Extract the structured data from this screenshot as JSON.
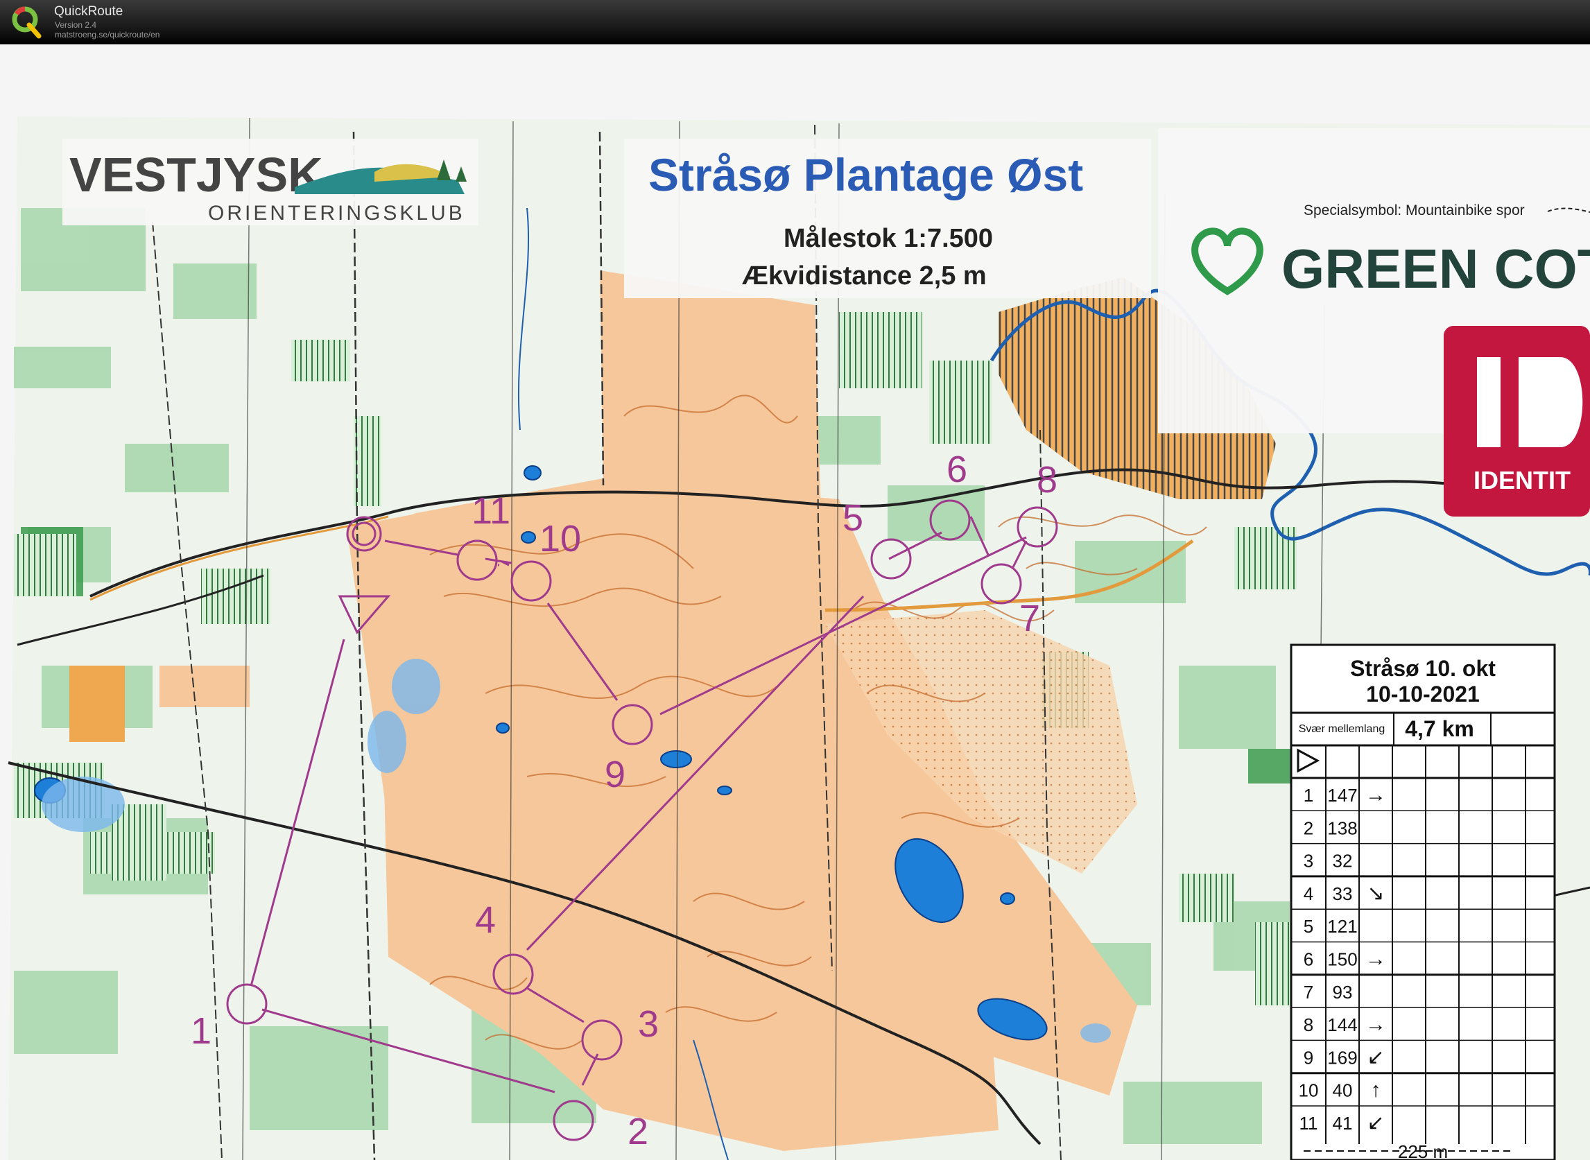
{
  "app": {
    "name": "QuickRoute",
    "version": "Version 2.4",
    "url": "matstroeng.se/quickroute/en"
  },
  "map": {
    "club_name": "VESTJYSK",
    "club_sub": "ORIENTERINGSKLUB",
    "title": "Stråsø Plantage Øst",
    "scale": "Målestok 1:7.500",
    "contour": "Ækvidistance 2,5 m",
    "special_symbol": "Specialsymbol: Mountainbike spor",
    "sponsor1": "GREEN COTTO",
    "sponsor2": "IDENTIT",
    "control_numbers": [
      "1",
      "2",
      "3",
      "4",
      "5",
      "6",
      "7",
      "8",
      "9",
      "10",
      "11"
    ]
  },
  "description_sheet": {
    "event": "Stråsø 10. okt",
    "date": "10-10-2021",
    "class": "Svær mellemlang",
    "distance": "4,7 km",
    "rows": [
      {
        "n": "1",
        "code": "147",
        "dir": "→"
      },
      {
        "n": "2",
        "code": "138",
        "dir": ""
      },
      {
        "n": "3",
        "code": "32",
        "dir": ""
      },
      {
        "n": "4",
        "code": "33",
        "dir": "↘"
      },
      {
        "n": "5",
        "code": "121",
        "dir": ""
      },
      {
        "n": "6",
        "code": "150",
        "dir": "→"
      },
      {
        "n": "7",
        "code": "93",
        "dir": ""
      },
      {
        "n": "8",
        "code": "144",
        "dir": "→"
      },
      {
        "n": "9",
        "code": "169",
        "dir": "↙"
      },
      {
        "n": "10",
        "code": "40",
        "dir": "↑"
      },
      {
        "n": "11",
        "code": "41",
        "dir": "↙"
      }
    ],
    "finish": "225 m"
  },
  "colors": {
    "course": "#a03a8c",
    "open_land": "#f6c79a",
    "forest_green": "#8fcf9a",
    "water": "#1e7fd8",
    "title_blue": "#2a5bb5"
  }
}
